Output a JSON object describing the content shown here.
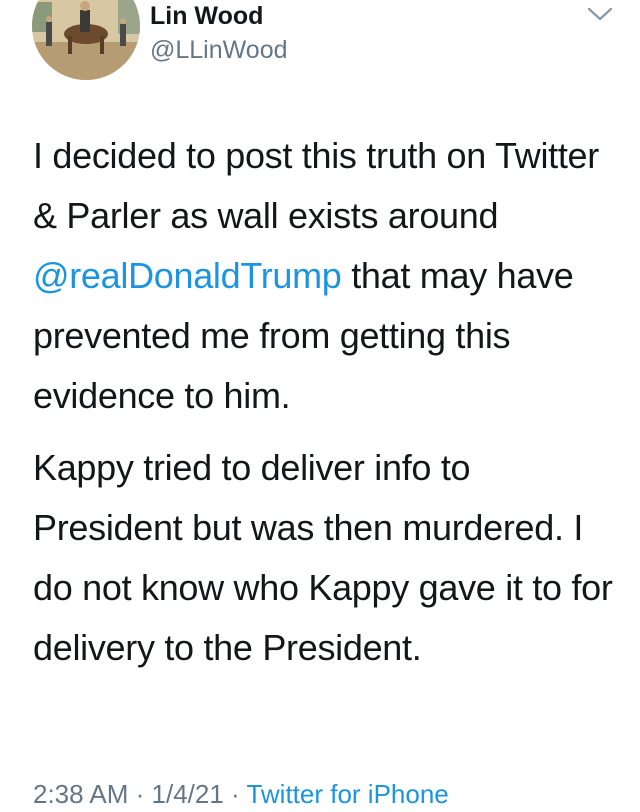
{
  "user": {
    "display_name": "Lin Wood",
    "handle": "@LLinWood"
  },
  "tweet": {
    "p1_before": "I decided to post this truth on Twitter & Parler as wall exists around ",
    "mention": "@realDonaldTrump",
    "p1_after": " that may have prevented me from getting this evidence to him.",
    "p2": "Kappy tried to deliver info to President but was then murdered. I do not know who Kappy gave it to for delivery to the President."
  },
  "meta": {
    "time": "2:38 AM",
    "sep1": " · ",
    "date": "1/4/21",
    "sep2": " · ",
    "source": "Twitter for iPhone"
  },
  "icons": {
    "menu": "chevron-down-icon"
  },
  "colors": {
    "link": "#1b95e0",
    "secondary_text": "#657786",
    "primary_text": "#14171a"
  }
}
